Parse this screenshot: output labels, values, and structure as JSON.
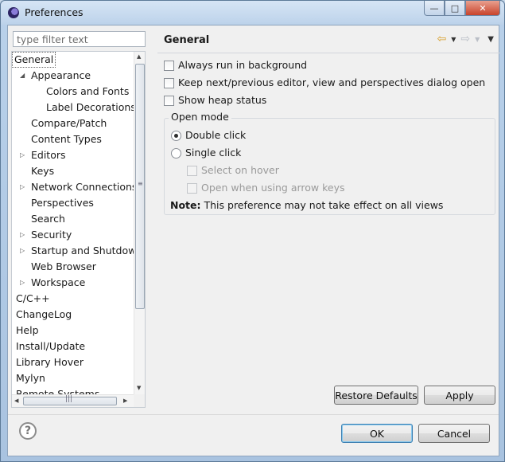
{
  "window": {
    "title": "Preferences",
    "controls": {
      "minimize": "—",
      "maximize": "□",
      "close": "✕"
    }
  },
  "filter": {
    "placeholder": "type filter text"
  },
  "tree": {
    "items": [
      {
        "label": "General",
        "level": 0,
        "arrow": "",
        "selected": true
      },
      {
        "label": "Appearance",
        "level": 1,
        "arrow": "◢"
      },
      {
        "label": "Colors and Fonts",
        "level": 2,
        "arrow": ""
      },
      {
        "label": "Label Decorations",
        "level": 2,
        "arrow": ""
      },
      {
        "label": "Compare/Patch",
        "level": 1,
        "arrow": ""
      },
      {
        "label": "Content Types",
        "level": 1,
        "arrow": ""
      },
      {
        "label": "Editors",
        "level": 1,
        "arrow": "▷"
      },
      {
        "label": "Keys",
        "level": 1,
        "arrow": ""
      },
      {
        "label": "Network Connections",
        "level": 1,
        "arrow": "▷"
      },
      {
        "label": "Perspectives",
        "level": 1,
        "arrow": ""
      },
      {
        "label": "Search",
        "level": 1,
        "arrow": ""
      },
      {
        "label": "Security",
        "level": 1,
        "arrow": "▷"
      },
      {
        "label": "Startup and Shutdown",
        "level": 1,
        "arrow": "▷"
      },
      {
        "label": "Web Browser",
        "level": 1,
        "arrow": ""
      },
      {
        "label": "Workspace",
        "level": 1,
        "arrow": "▷"
      },
      {
        "label": "C/C++",
        "level": 0,
        "arrow": ""
      },
      {
        "label": "ChangeLog",
        "level": 0,
        "arrow": ""
      },
      {
        "label": "Help",
        "level": 0,
        "arrow": ""
      },
      {
        "label": "Install/Update",
        "level": 0,
        "arrow": ""
      },
      {
        "label": "Library Hover",
        "level": 0,
        "arrow": ""
      },
      {
        "label": "Mylyn",
        "level": 0,
        "arrow": ""
      },
      {
        "label": "Remote Systems",
        "level": 0,
        "arrow": ""
      }
    ]
  },
  "page": {
    "title": "General",
    "nav": {
      "back_icon": "⇦",
      "forward_icon": "⇨",
      "dropdown_icon": "▼",
      "menu_icon": "▼"
    },
    "options": {
      "always_run_background": "Always run in background",
      "keep_next_previous": "Keep next/previous editor, view and perspectives dialog open",
      "show_heap_status": "Show heap status"
    },
    "open_mode": {
      "label": "Open mode",
      "double_click": "Double click",
      "single_click": "Single click",
      "select_on_hover": "Select on hover",
      "open_with_arrow_keys": "Open when using arrow keys",
      "selected": "Double click"
    },
    "note_label": "Note:",
    "note_text": " This preference may not take effect on all views"
  },
  "buttons": {
    "restore_defaults": "Restore Defaults",
    "apply": "Apply",
    "ok": "OK",
    "cancel": "Cancel"
  },
  "help_icon": "?"
}
